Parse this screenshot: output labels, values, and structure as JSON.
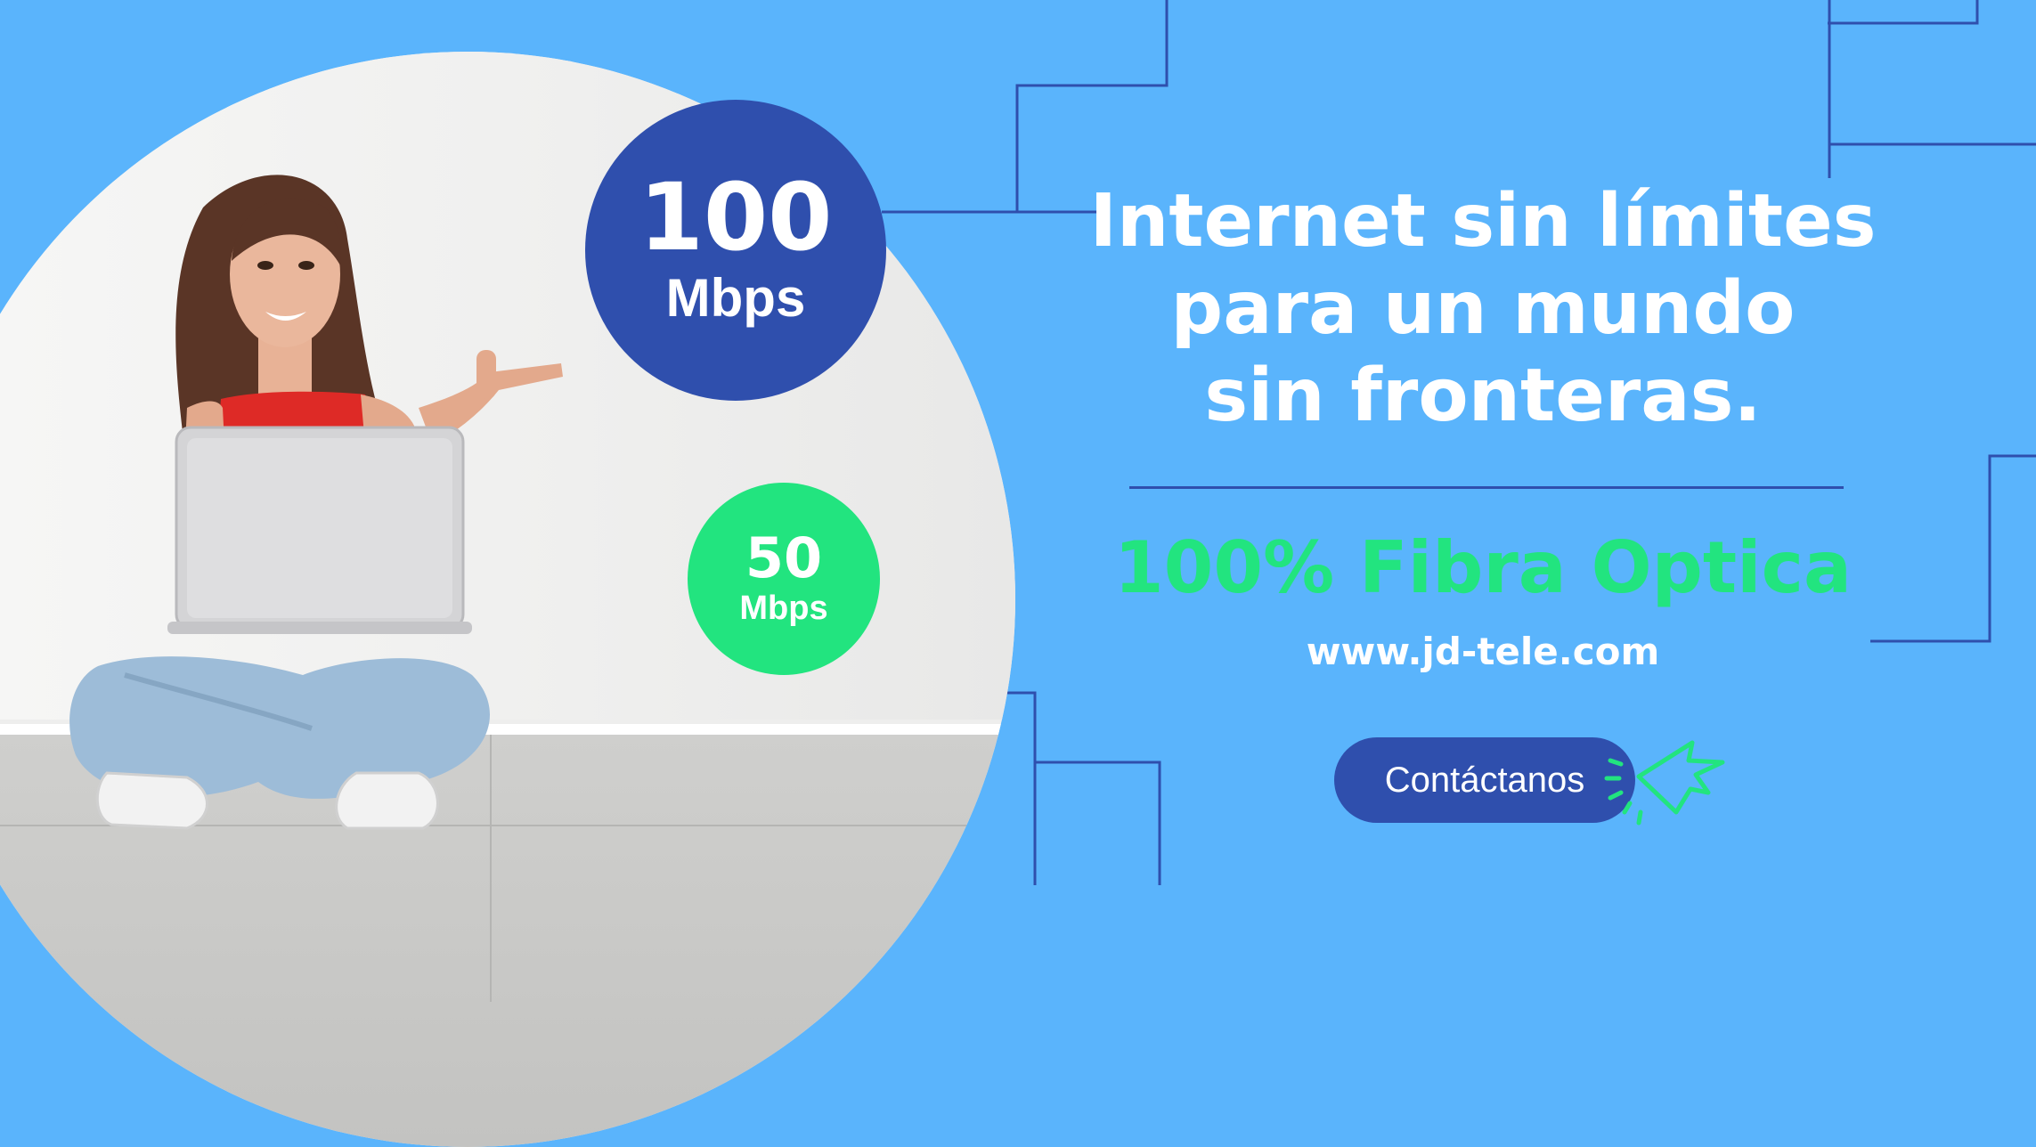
{
  "badges": {
    "primary": {
      "value": "100",
      "unit": "Mbps"
    },
    "secondary": {
      "value": "50",
      "unit": "Mbps"
    }
  },
  "headline": {
    "lines": [
      "Internet sin límites",
      "para un mundo",
      "sin fronteras."
    ]
  },
  "tagline": "100% Fibra Optica",
  "website": "www.jd-tele.com",
  "cta": {
    "label": "Contáctanos"
  },
  "icons": {
    "cursor": "click-cursor-icon"
  },
  "colors": {
    "background": "#5ab4fc",
    "navy": "#2f4fad",
    "green": "#22e47f",
    "white": "#ffffff"
  }
}
